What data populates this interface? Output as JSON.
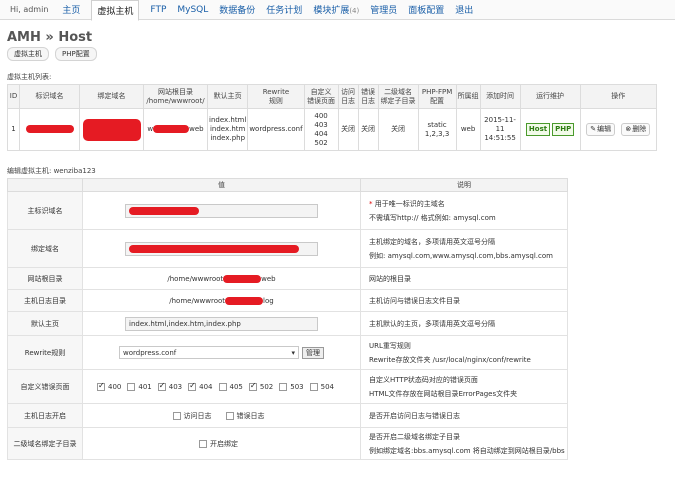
{
  "topnav": {
    "user": "Hi, admin",
    "items": [
      {
        "label": "主页"
      },
      {
        "label": "虚拟主机"
      },
      {
        "label": "FTP"
      },
      {
        "label": "MySQL"
      },
      {
        "label": "数据备份"
      },
      {
        "label": "任务计划"
      },
      {
        "label": "模块扩展",
        "badge": "(4)"
      },
      {
        "label": "管理员"
      },
      {
        "label": "面板配置"
      },
      {
        "label": "退出"
      }
    ]
  },
  "page": {
    "title": "AMH » Host",
    "subtabs": [
      "虚拟主机",
      "PHP配置"
    ],
    "list_label": "虚拟主机列表:",
    "edit_label": "编辑虚拟主机: wenziba123"
  },
  "host_table": {
    "headers": [
      "ID",
      "标识域名",
      "绑定域名",
      "网站根目录\n/home/wwwroot/",
      "默认主页",
      "Rewrite\n规则",
      "自定义\n错误页面",
      "访问\n日志",
      "错误\n日志",
      "二级域名\n绑定子目录",
      "PHP-FPM\n配置",
      "所属组",
      "添加时间",
      "运行维护",
      "操作"
    ],
    "row": {
      "id": "1",
      "root_suffix": "web",
      "root_prefix": "w",
      "default_page": "index.html\nindex.htm\nindex.php",
      "rewrite": "wordpress.conf",
      "error_pages": "400\n403\n404\n502",
      "access_log": "关闭",
      "error_log": "关闭",
      "subdir": "关闭",
      "php_fpm": "static\n1,2,3,3",
      "group": "web",
      "added": "2015-11-11\n14:51:55",
      "maint_host": "Host",
      "maint_php": "PHP",
      "edit": "编辑",
      "delete": "删除"
    }
  },
  "edit_table": {
    "col_value": "值",
    "col_desc": "说明",
    "rows": {
      "main_domain": {
        "label": "主标识域名",
        "desc1": "用于唯一标识的主域名",
        "desc2": "不需填写http:// 格式例如: amysql.com",
        "req": "*"
      },
      "bind_domain": {
        "label": "绑定域名",
        "desc1": "主机绑定的域名，多项请用英文逗号分隔",
        "desc2": "例如: amysql.com,www.amysql.com,bbs.amysql.com"
      },
      "web_root": {
        "label": "网站根目录",
        "value_prefix": "/home/wwwroot",
        "value_suffix": "web",
        "desc1": "网站的根目录"
      },
      "log_root": {
        "label": "主机日志目录",
        "value_prefix": "/home/wwwroot",
        "value_suffix": "log",
        "desc1": "主机访问与错误日志文件目录"
      },
      "index": {
        "label": "默认主页",
        "value": "index.html,index.htm,index.php",
        "desc1": "主机默认的主页，多项请用英文逗号分隔"
      },
      "rewrite": {
        "label": "Rewrite规则",
        "value": "wordpress.conf",
        "button": "管理",
        "desc1": "URL重写规则",
        "desc2": "Rewrite存放文件夹 /usr/local/nginx/conf/rewrite"
      },
      "error_pages": {
        "label": "自定义错误页面",
        "options": [
          {
            "code": "400",
            "checked": true
          },
          {
            "code": "401",
            "checked": false
          },
          {
            "code": "403",
            "checked": true
          },
          {
            "code": "404",
            "checked": true
          },
          {
            "code": "405",
            "checked": false
          },
          {
            "code": "502",
            "checked": true
          },
          {
            "code": "503",
            "checked": false
          },
          {
            "code": "504",
            "checked": false
          }
        ],
        "desc1": "自定义HTTP状态码对应的错误页面",
        "desc2": "HTML文件存放在网站根目录ErrorPages文件夹"
      },
      "logs": {
        "label": "主机日志开启",
        "opt1": "访问日志",
        "opt2": "错误日志",
        "desc1": "是否开启访问日志与错误日志"
      },
      "subdir": {
        "label": "二级域名绑定子目录",
        "opt1": "开启绑定",
        "desc1": "是否开启二级域名绑定子目录",
        "desc2": "例如绑定域名:bbs.amysql.com 将自动绑定到网站根目录/bbs"
      }
    }
  },
  "colors": {
    "redact": "#e51b23",
    "link": "#1a5fa8",
    "green": "#2e7d13"
  }
}
